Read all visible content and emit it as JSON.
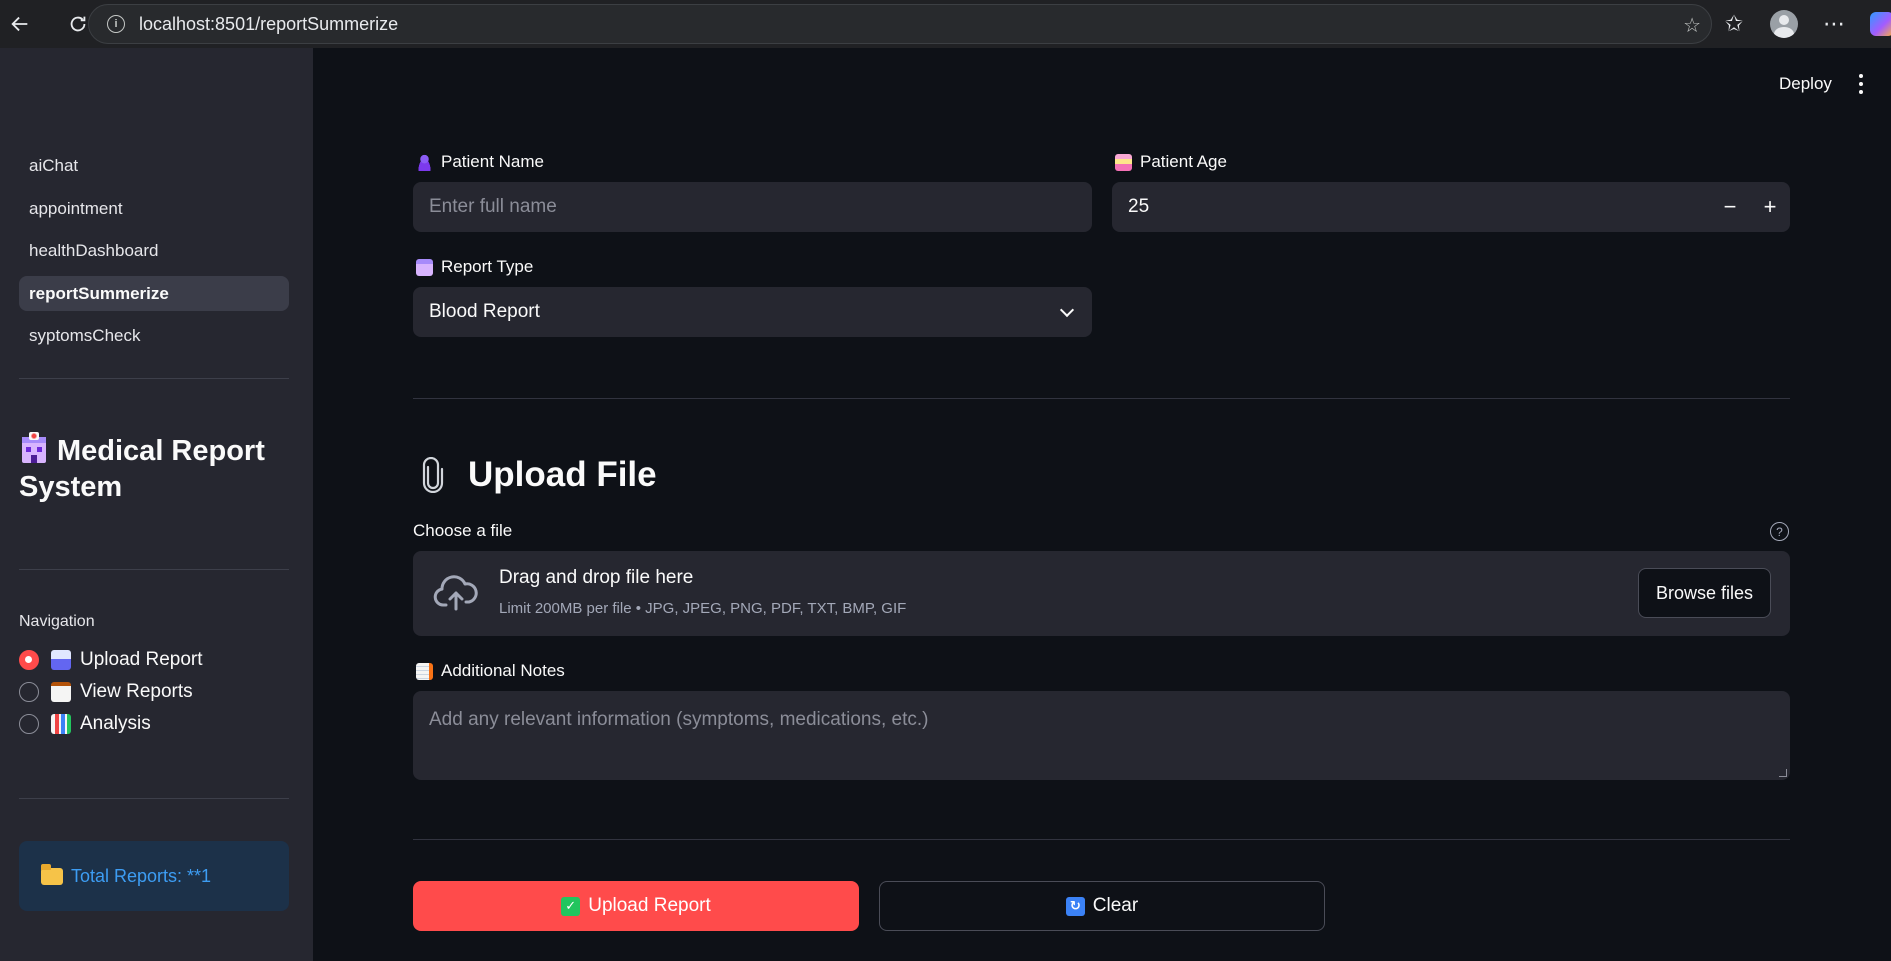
{
  "browser": {
    "url": "localhost:8501/reportSummerize"
  },
  "sidebar": {
    "pages": [
      {
        "label": "aiChat",
        "active": false
      },
      {
        "label": "appointment",
        "active": false
      },
      {
        "label": "healthDashboard",
        "active": false
      },
      {
        "label": "reportSummerize",
        "active": true
      },
      {
        "label": "syptomsCheck",
        "active": false
      }
    ],
    "title": "Medical Report System",
    "title_icon": "hospital-icon",
    "navigation_label": "Navigation",
    "navigation_options": [
      {
        "label": "Upload Report",
        "icon": "inbox-tray-icon",
        "selected": true
      },
      {
        "label": "View Reports",
        "icon": "clipboard-icon",
        "selected": false
      },
      {
        "label": "Analysis",
        "icon": "bar-chart-icon",
        "selected": false
      }
    ],
    "info_text": "Total Reports: **1",
    "info_icon": "folder-icon"
  },
  "header": {
    "deploy_label": "Deploy"
  },
  "form": {
    "patient_name_label": "Patient Name",
    "patient_name_placeholder": "Enter full name",
    "patient_age_label": "Patient Age",
    "patient_age_value": "25",
    "report_type_label": "Report Type",
    "report_type_value": "Blood Report",
    "upload_heading": "Upload File",
    "choose_file_label": "Choose a file",
    "dropzone_title": "Drag and drop file here",
    "dropzone_subtitle": "Limit 200MB per file • JPG, JPEG, PNG, PDF, TXT, BMP, GIF",
    "browse_label": "Browse files",
    "notes_label": "Additional Notes",
    "notes_placeholder": "Add any relevant information (symptoms, medications, etc.)",
    "upload_button_label": "Upload Report",
    "clear_button_label": "Clear"
  },
  "colors": {
    "primary": "#ff4b4b",
    "sidebar_bg": "#262730",
    "main_bg": "#0e1117",
    "info_text": "#3d9df3"
  }
}
